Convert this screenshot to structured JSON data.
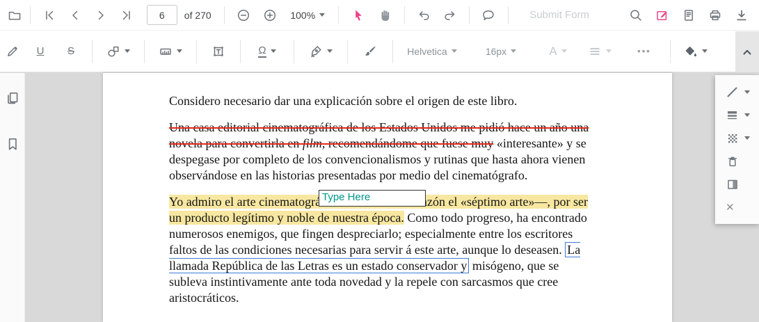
{
  "toolbar_top": {
    "page_value": "6",
    "page_total": "of 270",
    "zoom_level": "100%",
    "submit_form": "Submit Form",
    "icons": [
      "folder",
      "first-page",
      "prev-page",
      "next-page",
      "last-page",
      "zoom-out",
      "zoom-in",
      "select-tool",
      "pan-tool",
      "undo",
      "redo",
      "comment",
      "search",
      "edit-annotations",
      "notes",
      "print",
      "download"
    ]
  },
  "toolbar_format": {
    "underline_label": "U",
    "strikeout_label": "S",
    "stamp_glyph": "Ω",
    "font_family": "Helvetica",
    "font_size": "16px",
    "text_color_label": "A",
    "more_label": "•••",
    "icons": [
      "freehand-highlight",
      "underline",
      "strikeout",
      "shapes",
      "measure",
      "free-text",
      "stamp",
      "signature",
      "freehand-brush",
      "font-family-dropdown",
      "font-size-dropdown",
      "text-color",
      "alignment",
      "more-options",
      "fill-color",
      "collapse-toolbar"
    ]
  },
  "left_panel": {
    "icons": [
      "page-thumbnails",
      "bookmarks"
    ]
  },
  "tool_style_panel": {
    "icons": [
      "stroke-line",
      "stroke-thickness",
      "opacity",
      "delete",
      "fill-style",
      "close"
    ],
    "close_glyph": "✕"
  },
  "doc": {
    "p1": "Considero necesario dar una explicación sobre el origen de este libro.",
    "p2_strike_a": "Una casa editorial cinematográfica de los Estados Unidos me pidió hace un año una novela para convertirla en ",
    "p2_strike_italic": "film",
    "p2_strike_b": ", recomendándome que fuese muy",
    "p2_rest": " «interesante» y se despegase por completo de los convencionalismos y rutinas que hasta ahora vienen observándose en las historias presentadas por medio del cinematógrafo.",
    "free_text_value": "Type Here",
    "p3_highlight": "Yo admiro el arte cinematográfico—llamado con razón el «séptimo arte»—, por ser un producto legítimo y noble de nuestra época.",
    "p3_a": " Como todo progreso, ha encontrado numerosos enemigos, que fingen despreciarlo; especialmente entre los escritores faltos de las condiciones necesarias para servir á este arte, aunque lo deseasen. ",
    "p3_boxed": "La llamada República de las Letras es un estado conservador y",
    "p3_b": " misógeno, que se subleva instintivamente ante toda novedad y la repele con sarcasmos que cree aristocráticos."
  },
  "colors": {
    "accent_pink": "#e8468c",
    "strike_red": "#e2271b",
    "highlight_yellow": "#f7e7a1",
    "free_text_teal": "#00968b",
    "link_box_blue": "#3e7ad2",
    "viewer_bg": "#d9d9d9"
  }
}
